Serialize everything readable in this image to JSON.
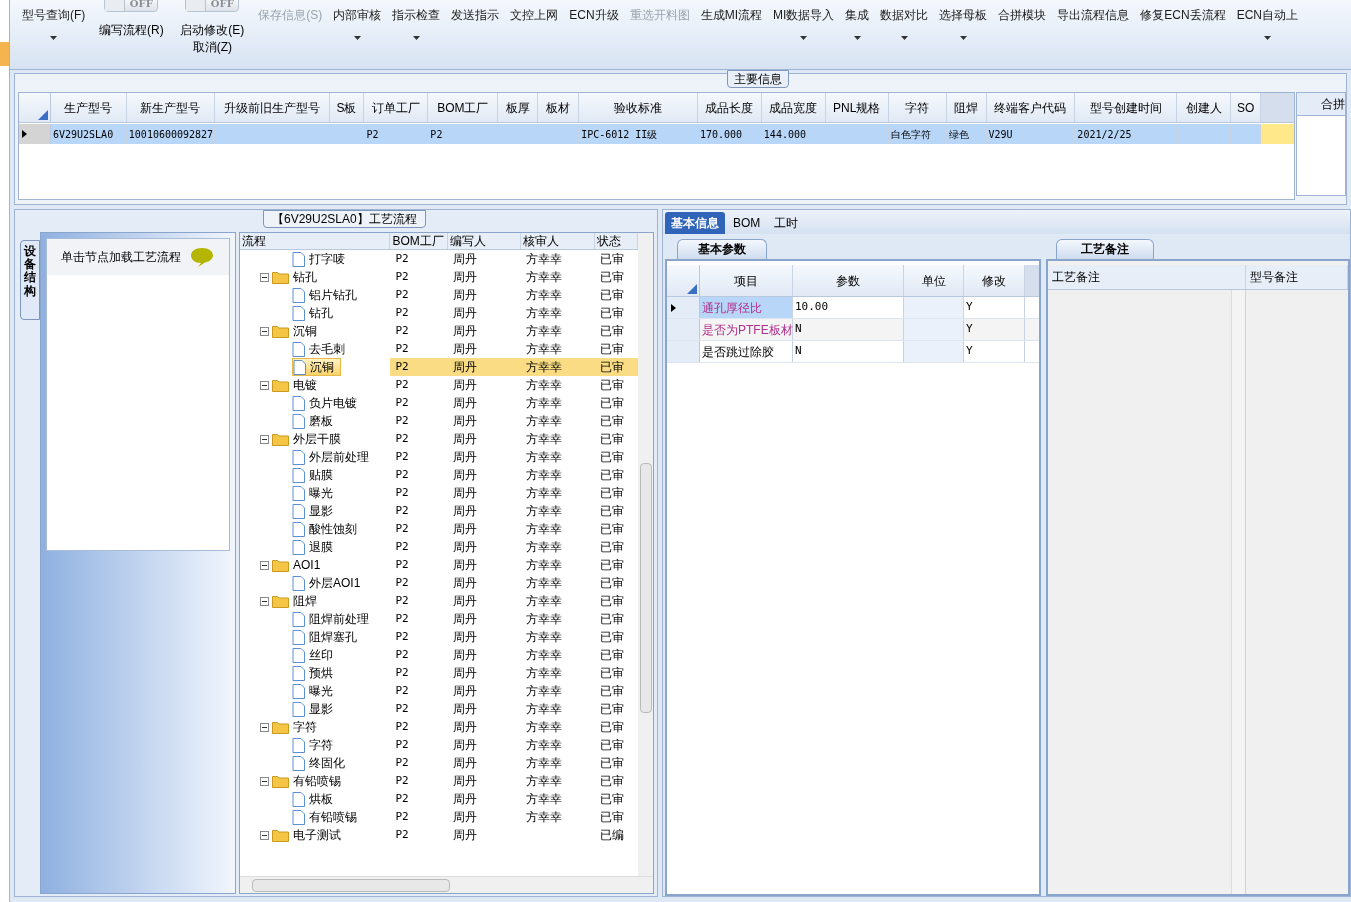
{
  "toolbar": [
    {
      "kind": "button",
      "label": "型号查询(F)",
      "disabled": false,
      "dropdown": true
    },
    {
      "kind": "toggle",
      "switch_text": "OFF",
      "on": false,
      "label": "编写流程(R)"
    },
    {
      "kind": "toggle",
      "switch_text": "OFF",
      "on": false,
      "label": "启动修改(E)",
      "sublabel": "取消(Z)"
    },
    {
      "kind": "button",
      "label": "保存信息(S)",
      "disabled": true,
      "dropdown": false
    },
    {
      "kind": "button",
      "label": "内部审核",
      "disabled": false,
      "dropdown": true
    },
    {
      "kind": "button",
      "label": "指示检查",
      "disabled": false,
      "dropdown": true
    },
    {
      "kind": "button",
      "label": "发送指示",
      "disabled": false,
      "dropdown": false
    },
    {
      "kind": "button",
      "label": "文控上网",
      "disabled": false,
      "dropdown": false
    },
    {
      "kind": "button",
      "label": "ECN升级",
      "disabled": false,
      "dropdown": false
    },
    {
      "kind": "button",
      "label": "重选开料图",
      "disabled": true,
      "dropdown": false
    },
    {
      "kind": "button",
      "label": "生成MI流程",
      "disabled": false,
      "dropdown": false
    },
    {
      "kind": "button",
      "label": "MI数据导入",
      "disabled": false,
      "dropdown": true
    },
    {
      "kind": "button",
      "label": "集成",
      "disabled": false,
      "dropdown": true
    },
    {
      "kind": "button",
      "label": "数据对比",
      "disabled": false,
      "dropdown": true
    },
    {
      "kind": "button",
      "label": "选择母板",
      "disabled": false,
      "dropdown": true
    },
    {
      "kind": "button",
      "label": "合拼模块",
      "disabled": false,
      "dropdown": false
    },
    {
      "kind": "button",
      "label": "导出流程信息",
      "disabled": false,
      "dropdown": false
    },
    {
      "kind": "button",
      "label": "修复ECN丢流程",
      "disabled": false,
      "dropdown": false
    },
    {
      "kind": "button",
      "label": "ECN自动上",
      "disabled": false,
      "dropdown": true
    }
  ],
  "main_info": {
    "title": "主要信息",
    "columns": [
      "生产型号",
      "新生产型号",
      "升级前旧生产型号",
      "S板",
      "订单工厂",
      "BOM工厂",
      "板厚",
      "板材",
      "验收标准",
      "成品长度",
      "成品宽度",
      "PNL规格",
      "字符",
      "阻焊",
      "终端客户代码",
      "型号创建时间",
      "创建人",
      "SO"
    ],
    "rows": [
      {
        "selected": true,
        "cells": [
          "6V29U2SLA0",
          "10010600092827",
          "",
          "",
          "P2",
          "P2",
          "",
          "",
          "IPC-6012 II级",
          "170.000",
          "144.000",
          "",
          "白色字符",
          "绿色",
          "V29U",
          "2021/2/25",
          "",
          ""
        ]
      }
    ],
    "side_panel_title": "合拼"
  },
  "process": {
    "title": "【6V29U2SLA0】工艺流程",
    "side_tab": "设备结构",
    "hint": "单击节点加载工艺流程",
    "columns": [
      "流程",
      "BOM工厂",
      "编写人",
      "核审人",
      "状态"
    ],
    "nodes": [
      {
        "kind": "file",
        "label": "打字唛",
        "factory": "P2",
        "writer": "周丹",
        "reviewer": "方幸幸",
        "status": "已审",
        "selected": false
      },
      {
        "kind": "folder",
        "label": "钻孔",
        "factory": "P2",
        "writer": "周丹",
        "reviewer": "方幸幸",
        "status": "已审",
        "selected": false,
        "expanded": true,
        "children": [
          {
            "kind": "file",
            "label": "铝片钻孔",
            "factory": "P2",
            "writer": "周丹",
            "reviewer": "方幸幸",
            "status": "已审",
            "selected": false
          },
          {
            "kind": "file",
            "label": "钻孔",
            "factory": "P2",
            "writer": "周丹",
            "reviewer": "方幸幸",
            "status": "已审",
            "selected": false
          }
        ]
      },
      {
        "kind": "folder",
        "label": "沉铜",
        "factory": "P2",
        "writer": "周丹",
        "reviewer": "方幸幸",
        "status": "已审",
        "selected": false,
        "expanded": true,
        "children": [
          {
            "kind": "file",
            "label": "去毛刺",
            "factory": "P2",
            "writer": "周丹",
            "reviewer": "方幸幸",
            "status": "已审",
            "selected": false
          },
          {
            "kind": "file",
            "label": "沉铜",
            "factory": "P2",
            "writer": "周丹",
            "reviewer": "方幸幸",
            "status": "已审",
            "selected": true
          }
        ]
      },
      {
        "kind": "folder",
        "label": "电镀",
        "factory": "P2",
        "writer": "周丹",
        "reviewer": "方幸幸",
        "status": "已审",
        "selected": false,
        "expanded": true,
        "children": [
          {
            "kind": "file",
            "label": "负片电镀",
            "factory": "P2",
            "writer": "周丹",
            "reviewer": "方幸幸",
            "status": "已审",
            "selected": false
          },
          {
            "kind": "file",
            "label": "磨板",
            "factory": "P2",
            "writer": "周丹",
            "reviewer": "方幸幸",
            "status": "已审",
            "selected": false
          }
        ]
      },
      {
        "kind": "folder",
        "label": "外层干膜",
        "factory": "P2",
        "writer": "周丹",
        "reviewer": "方幸幸",
        "status": "已审",
        "selected": false,
        "expanded": true,
        "children": [
          {
            "kind": "file",
            "label": "外层前处理",
            "factory": "P2",
            "writer": "周丹",
            "reviewer": "方幸幸",
            "status": "已审",
            "selected": false
          },
          {
            "kind": "file",
            "label": "贴膜",
            "factory": "P2",
            "writer": "周丹",
            "reviewer": "方幸幸",
            "status": "已审",
            "selected": false
          },
          {
            "kind": "file",
            "label": "曝光",
            "factory": "P2",
            "writer": "周丹",
            "reviewer": "方幸幸",
            "status": "已审",
            "selected": false
          },
          {
            "kind": "file",
            "label": "显影",
            "factory": "P2",
            "writer": "周丹",
            "reviewer": "方幸幸",
            "status": "已审",
            "selected": false
          },
          {
            "kind": "file",
            "label": "酸性蚀刻",
            "factory": "P2",
            "writer": "周丹",
            "reviewer": "方幸幸",
            "status": "已审",
            "selected": false
          },
          {
            "kind": "file",
            "label": "退膜",
            "factory": "P2",
            "writer": "周丹",
            "reviewer": "方幸幸",
            "status": "已审",
            "selected": false
          }
        ]
      },
      {
        "kind": "folder",
        "label": "AOI1",
        "factory": "P2",
        "writer": "周丹",
        "reviewer": "方幸幸",
        "status": "已审",
        "selected": false,
        "expanded": true,
        "children": [
          {
            "kind": "file",
            "label": "外层AOI1",
            "factory": "P2",
            "writer": "周丹",
            "reviewer": "方幸幸",
            "status": "已审",
            "selected": false
          }
        ]
      },
      {
        "kind": "folder",
        "label": "阻焊",
        "factory": "P2",
        "writer": "周丹",
        "reviewer": "方幸幸",
        "status": "已审",
        "selected": false,
        "expanded": true,
        "children": [
          {
            "kind": "file",
            "label": "阻焊前处理",
            "factory": "P2",
            "writer": "周丹",
            "reviewer": "方幸幸",
            "status": "已审",
            "selected": false
          },
          {
            "kind": "file",
            "label": "阻焊塞孔",
            "factory": "P2",
            "writer": "周丹",
            "reviewer": "方幸幸",
            "status": "已审",
            "selected": false
          },
          {
            "kind": "file",
            "label": "丝印",
            "factory": "P2",
            "writer": "周丹",
            "reviewer": "方幸幸",
            "status": "已审",
            "selected": false
          },
          {
            "kind": "file",
            "label": "预烘",
            "factory": "P2",
            "writer": "周丹",
            "reviewer": "方幸幸",
            "status": "已审",
            "selected": false
          },
          {
            "kind": "file",
            "label": "曝光",
            "factory": "P2",
            "writer": "周丹",
            "reviewer": "方幸幸",
            "status": "已审",
            "selected": false
          },
          {
            "kind": "file",
            "label": "显影",
            "factory": "P2",
            "writer": "周丹",
            "reviewer": "方幸幸",
            "status": "已审",
            "selected": false
          }
        ]
      },
      {
        "kind": "folder",
        "label": "字符",
        "factory": "P2",
        "writer": "周丹",
        "reviewer": "方幸幸",
        "status": "已审",
        "selected": false,
        "expanded": true,
        "children": [
          {
            "kind": "file",
            "label": "字符",
            "factory": "P2",
            "writer": "周丹",
            "reviewer": "方幸幸",
            "status": "已审",
            "selected": false
          },
          {
            "kind": "file",
            "label": "终固化",
            "factory": "P2",
            "writer": "周丹",
            "reviewer": "方幸幸",
            "status": "已审",
            "selected": false
          }
        ]
      },
      {
        "kind": "folder",
        "label": "有铅喷锡",
        "factory": "P2",
        "writer": "周丹",
        "reviewer": "方幸幸",
        "status": "已审",
        "selected": false,
        "expanded": true,
        "children": [
          {
            "kind": "file",
            "label": "烘板",
            "factory": "P2",
            "writer": "周丹",
            "reviewer": "方幸幸",
            "status": "已审",
            "selected": false
          },
          {
            "kind": "file",
            "label": "有铅喷锡",
            "factory": "P2",
            "writer": "周丹",
            "reviewer": "方幸幸",
            "status": "已审",
            "selected": false
          }
        ]
      },
      {
        "kind": "folder",
        "label": "电子测试",
        "factory": "P2",
        "writer": "周丹",
        "status": "已编",
        "selected": false,
        "expanded": true
      }
    ]
  },
  "detail": {
    "tabs": [
      {
        "label": "基本信息",
        "selected": true
      },
      {
        "label": "BOM",
        "selected": false
      },
      {
        "label": "工时",
        "selected": false
      }
    ],
    "params": {
      "tab": "基本参数",
      "columns": [
        "项目",
        "参数",
        "单位",
        "修改"
      ],
      "rows": [
        {
          "selected": true,
          "highlighted": true,
          "cells": [
            "通孔厚径比",
            "10.00",
            "",
            "Y"
          ]
        },
        {
          "selected": false,
          "highlighted": true,
          "cells": [
            "是否为PTFE板材",
            "N",
            "",
            "Y"
          ]
        },
        {
          "selected": false,
          "highlighted": false,
          "cells": [
            "是否跳过除胶",
            "N",
            "",
            "Y"
          ]
        }
      ]
    },
    "notes": {
      "tab": "工艺备注",
      "columns": [
        "工艺备注",
        "型号备注"
      ]
    }
  }
}
